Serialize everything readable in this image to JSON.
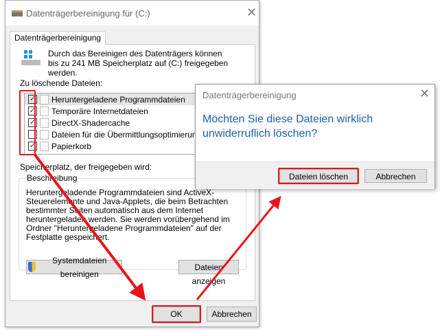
{
  "main_window": {
    "title": "Datenträgerbereinigung für  (C:)",
    "tab": "Datenträgerbereinigung",
    "intro": "Durch das Bereinigen des Datenträgers können bis zu 241 MB Speicherplatz auf  (C:) freigegeben werden.",
    "files_label": "Zu löschende Dateien:",
    "files": [
      {
        "label": "Heruntergeladene Programmdateien",
        "checked": true
      },
      {
        "label": "Temporäre Internetdateien",
        "checked": true
      },
      {
        "label": "DirectX-Shadercache",
        "checked": true
      },
      {
        "label": "Dateien für die Übermittlungsoptimierung",
        "checked": false
      },
      {
        "label": "Papierkorb",
        "checked": true
      }
    ],
    "space_label": "Speicherplatz, der freigegeben wird:",
    "description_title": "Beschreibung",
    "description": "Heruntergeladende Programmdateien sind ActiveX-Steuerelemente und Java-Applets, die beim Betrachten bestimmter Seiten automatisch aus dem Internet heruntergeladen werden. Sie werden vorübergehend im Ordner \"Heruntergeladene Programmdateien\" auf der Festplatte gespeichert.",
    "system_button": "Systemdateien bereinigen",
    "show_files_button": "Dateien anzeigen",
    "ok": "OK",
    "cancel": "Abbrechen"
  },
  "dialog": {
    "title": "Datenträgerbereinigung",
    "message": "Möchten Sie diese Dateien wirklich unwiderruflich löschen?",
    "confirm": "Dateien löschen",
    "cancel": "Abbrechen"
  },
  "colors": {
    "annotation": "#e8141c",
    "message": "#1a5fb4"
  }
}
